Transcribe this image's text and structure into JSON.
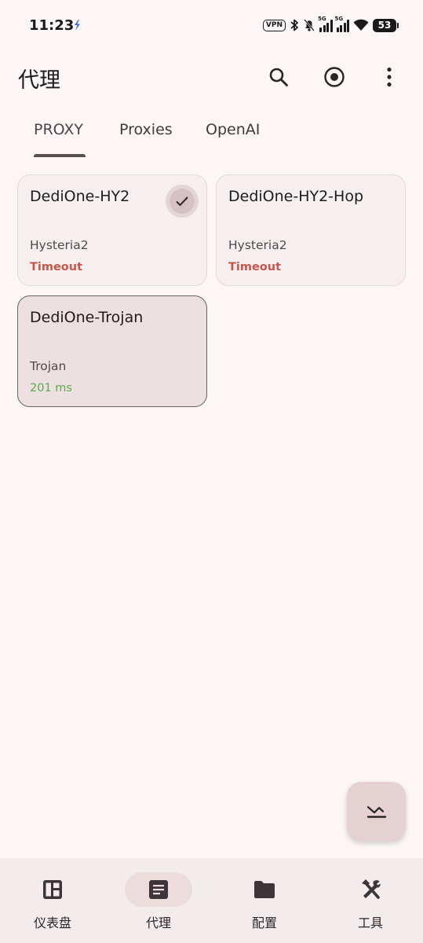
{
  "status_bar": {
    "time": "11:23",
    "vpn": "VPN",
    "sim1_tag": "5G",
    "sim2_tag": "5G",
    "battery": "53"
  },
  "app_bar": {
    "title": "代理",
    "icons": [
      "search-icon",
      "target-icon",
      "more-vert-icon"
    ]
  },
  "tabs": [
    {
      "label": "PROXY",
      "active": true
    },
    {
      "label": "Proxies",
      "active": false
    },
    {
      "label": "OpenAI",
      "active": false
    }
  ],
  "proxies": [
    {
      "name": "DediOne-HY2",
      "type": "Hysteria2",
      "delay": "Timeout",
      "checked": true
    },
    {
      "name": "DediOne-HY2-Hop",
      "type": "Hysteria2",
      "delay": "Timeout",
      "checked": false
    },
    {
      "name": "DediOne-Trojan",
      "type": "Trojan",
      "delay": "201 ms",
      "selected": true
    }
  ],
  "fab": {
    "icon": "collapse-icon"
  },
  "bottom_nav": [
    {
      "label": "仪表盘",
      "icon": "dashboard-icon",
      "active": false
    },
    {
      "label": "代理",
      "icon": "article-icon",
      "active": true
    },
    {
      "label": "配置",
      "icon": "folder-icon",
      "active": false
    },
    {
      "label": "工具",
      "icon": "tools-icon",
      "active": false
    }
  ],
  "colors": {
    "background": "#fcf7f6",
    "timeout": "#c9564a",
    "ok": "#5ea94f",
    "selected_card": "#ece0e0"
  }
}
